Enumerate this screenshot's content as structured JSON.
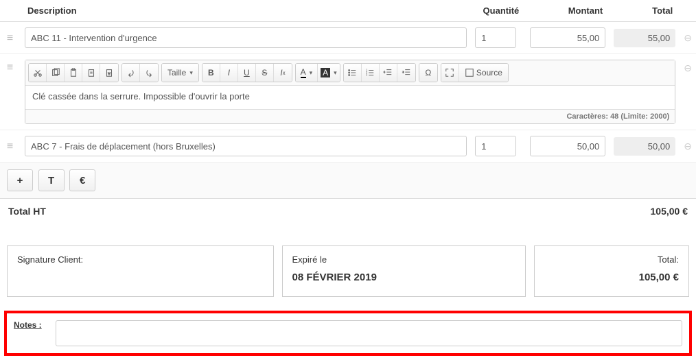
{
  "headers": {
    "description": "Description",
    "quantity": "Quantité",
    "amount": "Montant",
    "total": "Total"
  },
  "lines": [
    {
      "description": "ABC 11 - Intervention d'urgence",
      "quantity": "1",
      "amount": "55,00",
      "total": "55,00"
    },
    {
      "description": "ABC 7 - Frais de déplacement (hors Bruxelles)",
      "quantity": "1",
      "amount": "50,00",
      "total": "50,00"
    }
  ],
  "editor": {
    "content": "Clé cassée dans la serrure. Impossible d'ouvrir la porte",
    "footer": "Caractères: 48 (Limite: 2000)",
    "size_label": "Taille",
    "source_label": "Source"
  },
  "total_ht": {
    "label": "Total HT",
    "value": "105,00 €"
  },
  "signature": {
    "label": "Signature Client:"
  },
  "expiry": {
    "label": "Expiré le",
    "value": "08 FÉVRIER 2019"
  },
  "grand_total": {
    "label": "Total:",
    "value": "105,00 €"
  },
  "notes": {
    "label": "Notes :",
    "value": ""
  }
}
